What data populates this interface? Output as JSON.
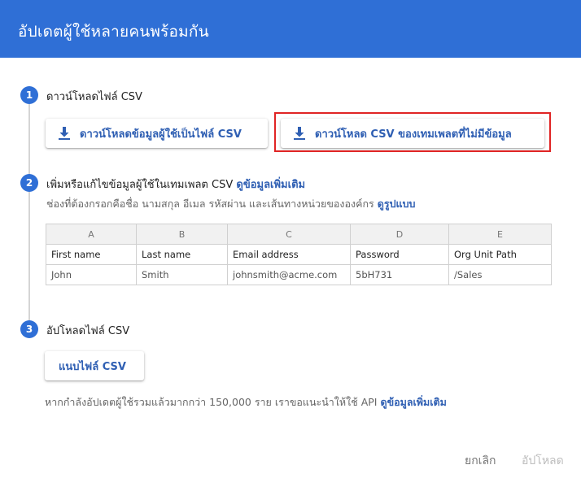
{
  "header": {
    "title": "อัปเดตผู้ใช้หลายคนพร้อมกัน",
    "color": "#2f6fd6"
  },
  "steps": [
    {
      "number": "1",
      "title": "ดาวน์โหลดไฟล์ CSV",
      "buttons": [
        {
          "label": "ดาวน์โหลดข้อมูลผู้ใช้เป็นไฟล์ CSV",
          "icon": "download-icon"
        },
        {
          "label": "ดาวน์โหลด CSV ของเทมเพลตที่ไม่มีข้อมูล",
          "icon": "download-icon",
          "highlighted": true
        }
      ]
    },
    {
      "number": "2",
      "title": "เพิ่มหรือแก้ไขข้อมูลผู้ใช้ในเทมเพลต CSV",
      "learn_more": "ดูข้อมูลเพิ่มเติม",
      "hint": "ช่องที่ต้องกรอกคือชื่อ นามสกุล อีเมล รหัสผ่าน และเส้นทางหน่วยขององค์กร",
      "example_link": "ดูรูปแบบ"
    },
    {
      "number": "3",
      "title": "อัปโหลดไฟล์ CSV",
      "attach_label": "แนบไฟล์ CSV",
      "note": "หากกำลังอัปเดตผู้ใช้รวมแล้วมากกว่า 150,000 ราย เราขอแนะนำให้ใช้ API",
      "note_link": "ดูข้อมูลเพิ่มเติม"
    }
  ],
  "table": {
    "column_letters": [
      "A",
      "B",
      "C",
      "D",
      "E"
    ],
    "headers": [
      "First name",
      "Last name",
      "Email address",
      "Password",
      "Org Unit Path"
    ],
    "row": [
      "John",
      "Smith",
      "johnsmith@acme.com",
      "5bH731",
      "/Sales"
    ]
  },
  "footer": {
    "cancel": "ยกเลิก",
    "upload": "อัปโหลด"
  },
  "colors": {
    "accent": "#2f6fd6",
    "link": "#2f5fb3",
    "highlight": "#e02424"
  }
}
